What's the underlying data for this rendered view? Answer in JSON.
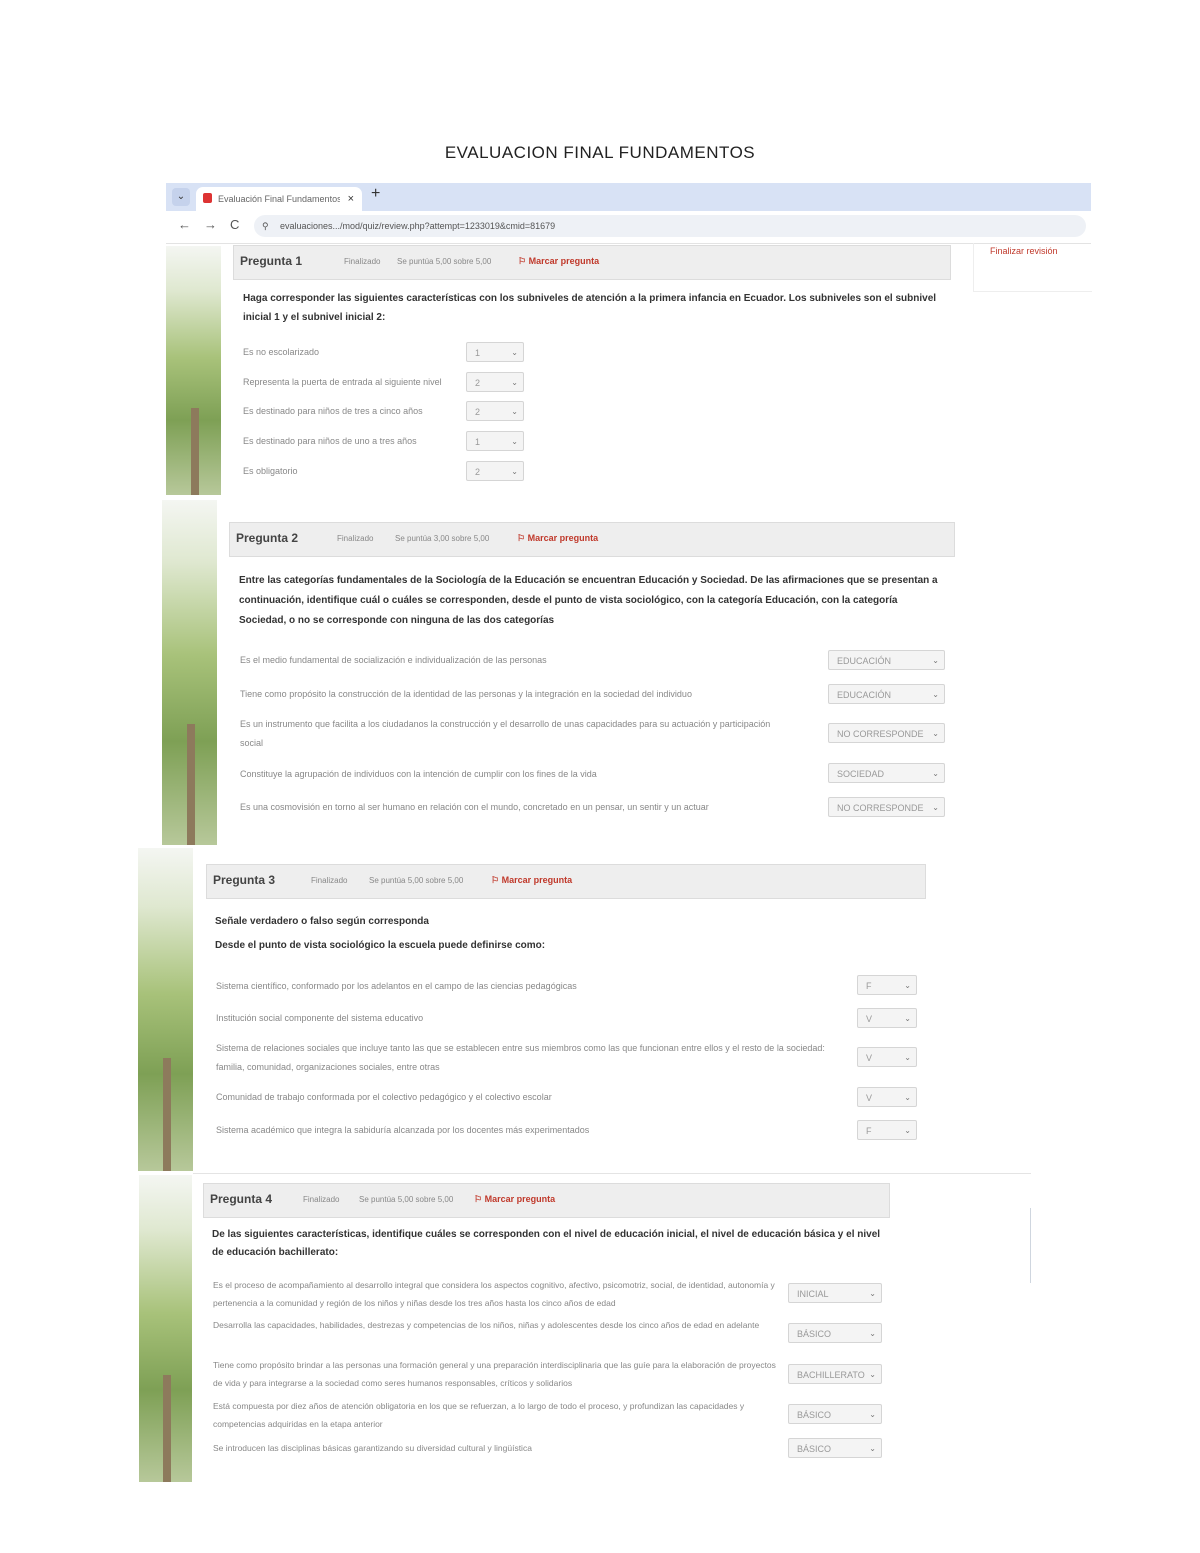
{
  "document": {
    "title": "EVALUACION FINAL FUNDAMENTOS"
  },
  "browser": {
    "tab_title": "Evaluación Final Fundamentos de",
    "tab_close": "×",
    "new_tab": "+",
    "dropdown": "⌄",
    "nav_back": "←",
    "nav_forward": "→",
    "nav_reload": "C",
    "url": "evaluaciones.../mod/quiz/review.php?attempt=1233019&cmid=81679",
    "lock": "⚲"
  },
  "sidebar": {
    "finish_label": "Finalizar revisión"
  },
  "questions": [
    {
      "number": "Pregunta 1",
      "status": "Finalizado",
      "score": "Se puntúa 5,00 sobre 5,00",
      "flag": "Marcar pregunta",
      "prompt": "Haga corresponder las siguientes características con los subniveles de atención a la primera infancia en Ecuador. Los subniveles son el subnivel inicial 1 y el subnivel inicial 2:",
      "items": [
        {
          "text": "Es no escolarizado",
          "answer": "1"
        },
        {
          "text": "Representa la puerta de entrada al siguiente nivel",
          "answer": "2"
        },
        {
          "text": "Es destinado para niños de tres a cinco años",
          "answer": "2"
        },
        {
          "text": "Es destinado para niños de uno a tres años",
          "answer": "1"
        },
        {
          "text": "Es obligatorio",
          "answer": "2"
        }
      ]
    },
    {
      "number": "Pregunta 2",
      "status": "Finalizado",
      "score": "Se puntúa 3,00 sobre 5,00",
      "flag": "Marcar pregunta",
      "prompt": "Entre las categorías fundamentales de la Sociología de la Educación se encuentran Educación y Sociedad. De las afirmaciones que se presentan a continuación, identifique cuál o cuáles se corresponden, desde el punto de vista sociológico, con la categoría Educación, con la categoría Sociedad, o no se corresponde con ninguna de las dos categorías",
      "items": [
        {
          "text": "Es el medio fundamental de socialización e individualización de las personas",
          "answer": "EDUCACIÓN"
        },
        {
          "text": "Tiene como propósito la construcción de la identidad de las personas y la integración en la sociedad del individuo",
          "answer": "EDUCACIÓN"
        },
        {
          "text": "Es un instrumento que facilita a los ciudadanos la construcción y el desarrollo de unas capacidades para su actuación y participación social",
          "answer": "NO CORRESPONDE"
        },
        {
          "text": "Constituye la agrupación de individuos con la intención de cumplir con los fines de la vida",
          "answer": "SOCIEDAD"
        },
        {
          "text": "Es una cosmovisión en torno al ser humano en relación con el mundo, concretado en un pensar, un sentir y un actuar",
          "answer": "NO CORRESPONDE"
        }
      ]
    },
    {
      "number": "Pregunta 3",
      "status": "Finalizado",
      "score": "Se puntúa 5,00 sobre 5,00",
      "flag": "Marcar pregunta",
      "prompt": "Señale verdadero o falso según corresponda",
      "subprompt": "Desde el punto de vista sociológico la escuela puede definirse como:",
      "items": [
        {
          "text": "Sistema científico, conformado por los adelantos en el campo de las ciencias pedagógicas",
          "answer": "F"
        },
        {
          "text": "Institución social componente del sistema educativo",
          "answer": "V"
        },
        {
          "text": "Sistema de relaciones sociales que incluye tanto las que se establecen entre sus miembros como las que funcionan entre ellos y el resto de la sociedad: familia, comunidad, organizaciones sociales, entre otras",
          "answer": "V"
        },
        {
          "text": "Comunidad de trabajo conformada por el colectivo pedagógico y el colectivo escolar",
          "answer": "V"
        },
        {
          "text": "Sistema académico que integra la sabiduría alcanzada por los docentes más experimentados",
          "answer": "F"
        }
      ]
    },
    {
      "number": "Pregunta 4",
      "status": "Finalizado",
      "score": "Se puntúa 5,00 sobre 5,00",
      "flag": "Marcar pregunta",
      "prompt": "De las siguientes características, identifique cuáles se corresponden con el nivel de educación inicial, el nivel de educación básica y el nivel de educación bachillerato:",
      "items": [
        {
          "text": "Es el proceso de acompañamiento al desarrollo integral que considera los aspectos cognitivo, afectivo, psicomotriz, social, de identidad, autonomía y pertenencia a la comunidad y región de los niños y niñas desde los tres años hasta los cinco años de edad",
          "answer": "INICIAL"
        },
        {
          "text": "Desarrolla las capacidades, habilidades, destrezas y competencias de los niños, niñas y adolescentes desde los cinco años de edad en adelante",
          "answer": "BÁSICO"
        },
        {
          "text": "Tiene como propósito brindar a las personas una formación general y una preparación interdisciplinaria que las guíe para la elaboración de proyectos de vida y para integrarse a la sociedad como seres humanos responsables, críticos y solidarios",
          "answer": "BACHILLERATO"
        },
        {
          "text": "Está compuesta por diez años de atención obligatoria en los que se refuerzan, a lo largo de todo el proceso, y profundizan las capacidades y competencias adquiridas en la etapa anterior",
          "answer": "BÁSICO"
        },
        {
          "text": "Se introducen las disciplinas básicas garantizando su diversidad cultural y lingüística",
          "answer": "BÁSICO"
        }
      ]
    }
  ],
  "icons": {
    "flag_icon": "⚐",
    "chevron_icon": "⌄"
  }
}
